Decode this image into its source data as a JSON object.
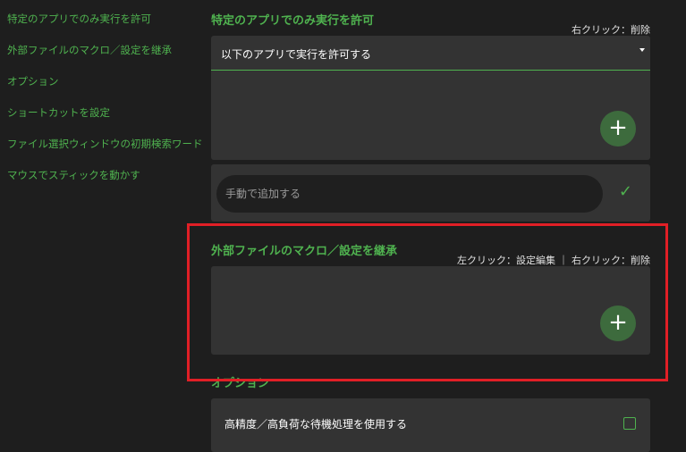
{
  "sidebar": {
    "items": [
      {
        "label": "特定のアプリでのみ実行を許可"
      },
      {
        "label": "外部ファイルのマクロ／設定を継承"
      },
      {
        "label": "オプション"
      },
      {
        "label": "ショートカットを設定"
      },
      {
        "label": "ファイル選択ウィンドウの初期検索ワード"
      },
      {
        "label": "マウスでスティックを動かす"
      }
    ]
  },
  "sections": {
    "allowed_apps": {
      "title": "特定のアプリでのみ実行を許可",
      "hint": "右クリック：削除",
      "dropdown_value": "以下のアプリで実行を許可する",
      "add_button": "+",
      "manual_input_placeholder": "手動で追加する",
      "confirm_icon": "✓"
    },
    "inherit_macro": {
      "title": "外部ファイルのマクロ／設定を継承",
      "hint": "左クリック：設定編集 ｜ 右クリック：削除",
      "add_button": "+"
    },
    "options": {
      "title": "オプション",
      "high_precision_label": "高精度／高負荷な待機処理を使用する",
      "high_precision_checked": false
    }
  },
  "colors": {
    "accent_green": "#4fb24f",
    "highlight_red": "#e11f26",
    "panel_bg": "#333333",
    "page_bg": "#1e1e1e"
  }
}
